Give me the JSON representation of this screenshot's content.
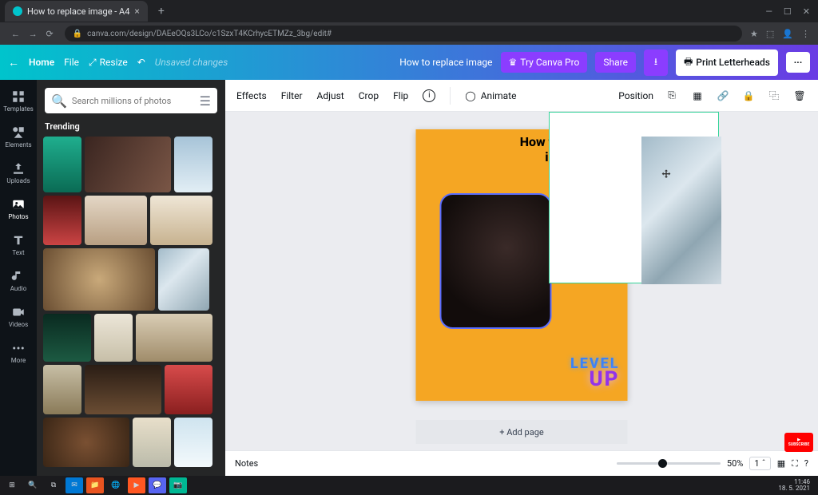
{
  "browser": {
    "tab_title": "How to replace image - A4",
    "url": "canva.com/design/DAEeOQs3LCo/c1SzxT4KCrhycETMZz_3bg/edit#"
  },
  "topbar": {
    "home": "Home",
    "file": "File",
    "resize": "Resize",
    "unsaved": "Unsaved changes",
    "doc_title": "How to replace image",
    "try_pro": "Try Canva Pro",
    "share": "Share",
    "print": "Print Letterheads"
  },
  "rail": {
    "templates": "Templates",
    "elements": "Elements",
    "uploads": "Uploads",
    "photos": "Photos",
    "text": "Text",
    "audio": "Audio",
    "videos": "Videos",
    "more": "More"
  },
  "sidepanel": {
    "search_placeholder": "Search millions of photos",
    "trending": "Trending"
  },
  "toolbar": {
    "effects": "Effects",
    "filter": "Filter",
    "adjust": "Adjust",
    "crop": "Crop",
    "flip": "Flip",
    "animate": "Animate",
    "position": "Position"
  },
  "canvas": {
    "heading": "How to replace image",
    "level": "LEVEL",
    "up": "UP",
    "add_page": "+ Add page"
  },
  "bottombar": {
    "notes": "Notes",
    "zoom": "50%",
    "page": "1"
  },
  "taskbar": {
    "time": "11:46",
    "date": "18. 5. 2021"
  }
}
